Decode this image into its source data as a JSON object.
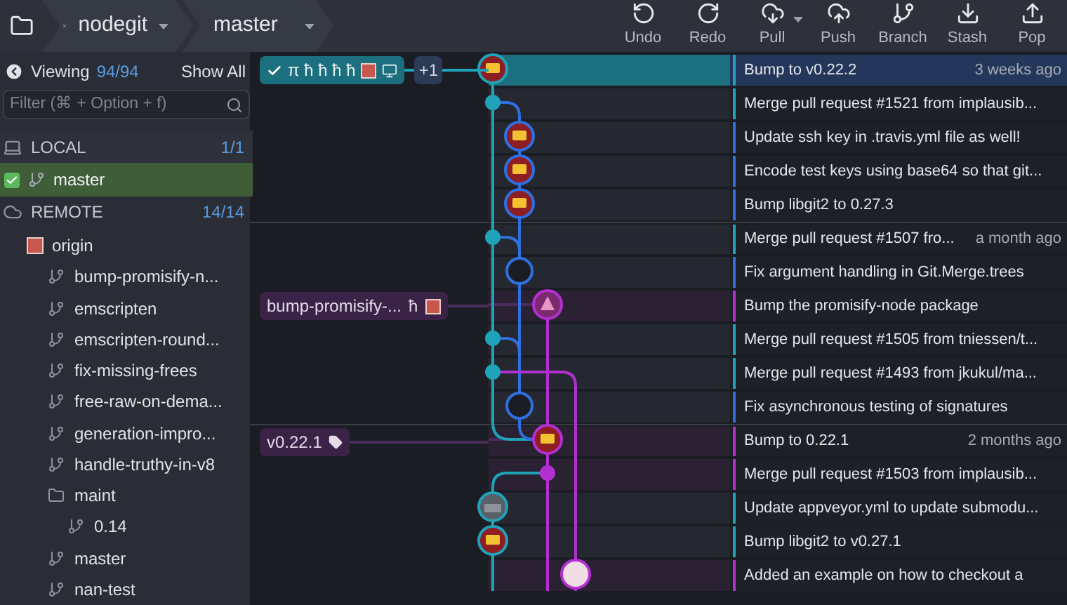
{
  "breadcrumbs": [
    {
      "label": "nodegit",
      "closable": true
    },
    {
      "label": "master",
      "closable": false
    }
  ],
  "toolbar": [
    {
      "label": "Undo",
      "kind": "undo"
    },
    {
      "label": "Redo",
      "kind": "redo"
    },
    {
      "label": "Pull",
      "kind": "pull"
    },
    {
      "label": "Push",
      "kind": "push"
    },
    {
      "label": "Branch",
      "kind": "branch"
    },
    {
      "label": "Stash",
      "kind": "stash"
    },
    {
      "label": "Pop",
      "kind": "pop"
    }
  ],
  "sidebar": {
    "viewing_label": "Viewing",
    "viewing_count": "94/94",
    "show_all": "Show All",
    "filter": {
      "placeholder": "Filter (⌘ + Option + f)"
    },
    "local": {
      "title": "LOCAL",
      "count": "1/1",
      "branches": [
        {
          "name": "master",
          "checked": true,
          "selected": true
        }
      ]
    },
    "remote": {
      "title": "REMOTE",
      "count": "14/14",
      "remotes": [
        {
          "name": "origin",
          "children": [
            {
              "name": "bump-promisify-n...",
              "kind": "branch"
            },
            {
              "name": "emscripten",
              "kind": "branch"
            },
            {
              "name": "emscripten-round...",
              "kind": "branch"
            },
            {
              "name": "fix-missing-frees",
              "kind": "branch"
            },
            {
              "name": "free-raw-on-dema...",
              "kind": "branch"
            },
            {
              "name": "generation-impro...",
              "kind": "branch"
            },
            {
              "name": "handle-truthy-in-v8",
              "kind": "branch"
            },
            {
              "name": "maint",
              "kind": "folder",
              "children": [
                {
                  "name": "0.14",
                  "kind": "branch"
                }
              ]
            },
            {
              "name": "master",
              "kind": "branch"
            },
            {
              "name": "nan-test",
              "kind": "branch"
            }
          ]
        }
      ]
    }
  },
  "commits": [
    {
      "message": "Bump to v0.22.2",
      "time": "3 weeks ago",
      "color": "#1fa3b8",
      "selected": true,
      "ref": {
        "kind": "head",
        "text": "π ħ ħ ħ ħ",
        "extra": "+1"
      }
    },
    {
      "message": "Merge pull request #1521 from implausib...",
      "color": "#1fa3b8",
      "selected": false
    },
    {
      "message": "Update ssh key in .travis.yml file as well!",
      "color": "#2f6fe0",
      "selected": false
    },
    {
      "message": "Encode test keys using base64 so that git...",
      "color": "#2f6fe0",
      "selected": false
    },
    {
      "message": "Bump libgit2 to 0.27.3",
      "color": "#2f6fe0",
      "selected": false
    },
    {
      "message": "Merge pull request #1507 fro...",
      "time": "a month ago",
      "color": "#1fa3b8",
      "selected": false
    },
    {
      "message": "Fix argument handling in Git.Merge.trees",
      "color": "#2f6fe0",
      "selected": false
    },
    {
      "message": "Bump the promisify-node package",
      "color": "#b42fd0",
      "selected": false,
      "ref": {
        "kind": "branch",
        "text": "bump-promisify-...",
        "extra": "ħ"
      }
    },
    {
      "message": "Merge pull request #1505 from tniessen/t...",
      "color": "#1fa3b8",
      "selected": false
    },
    {
      "message": "Merge pull request #1493 from jkukul/ma...",
      "color": "#1fa3b8",
      "selected": false
    },
    {
      "message": "Fix asynchronous testing of signatures",
      "color": "#2f6fe0",
      "selected": false
    },
    {
      "message": "Bump to 0.22.1",
      "time": "2 months ago",
      "color": "#b42fd0",
      "selected": false,
      "ref": {
        "kind": "tag",
        "text": "v0.22.1"
      }
    },
    {
      "message": "Merge pull request #1503 from implausib...",
      "color": "#b42fd0",
      "selected": false
    },
    {
      "message": "Update appveyor.yml to update submodu...",
      "color": "#1fa3b8",
      "selected": false
    },
    {
      "message": "Bump libgit2 to v0.27.1",
      "color": "#1fa3b8",
      "selected": false
    },
    {
      "message": "Added an example on how to checkout a",
      "color": "#b42fd0",
      "selected": false
    }
  ]
}
